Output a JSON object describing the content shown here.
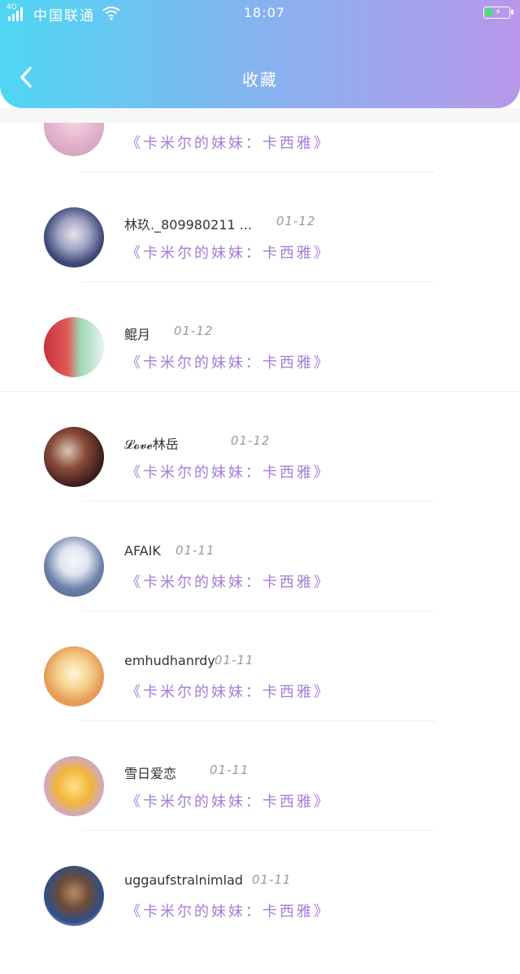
{
  "status_bar": {
    "network_tag": "4G",
    "carrier": "中国联通",
    "time": "18:07"
  },
  "header": {
    "title": "收藏"
  },
  "colors": {
    "gradient_start": "#4fd6f3",
    "gradient_end": "#b897ea",
    "work_title": "#a57ed6",
    "date": "#9a9a9a"
  },
  "items": [
    {
      "name": "",
      "date": "",
      "work": "《卡米尔的妹妹：卡西雅》",
      "avatar": "avatar-partial"
    },
    {
      "name": "林玖._809980211 ...",
      "date": "01-12",
      "work": "《卡米尔的妹妹：卡西雅》",
      "avatar": "avatar"
    },
    {
      "name": "鲲月",
      "date": "01-12",
      "work": "《卡米尔的妹妹：卡西雅》",
      "avatar": "avatar"
    },
    {
      "name": "𝓛𝓸𝓿𝓮林岳",
      "date": "01-12",
      "work": "《卡米尔的妹妹：卡西雅》",
      "avatar": "avatar"
    },
    {
      "name": "AFAIK",
      "date": "01-11",
      "work": "《卡米尔的妹妹：卡西雅》",
      "avatar": "avatar"
    },
    {
      "name": "emhudhanrdy",
      "date": "01-11",
      "work": "《卡米尔的妹妹：卡西雅》",
      "avatar": "avatar"
    },
    {
      "name": "雪日爱恋",
      "date": "01-11",
      "work": "《卡米尔的妹妹：卡西雅》",
      "avatar": "avatar"
    },
    {
      "name": "uggaufstralnimlad",
      "date": "01-11",
      "work": "《卡米尔的妹妹：卡西雅》",
      "avatar": "avatar"
    }
  ]
}
